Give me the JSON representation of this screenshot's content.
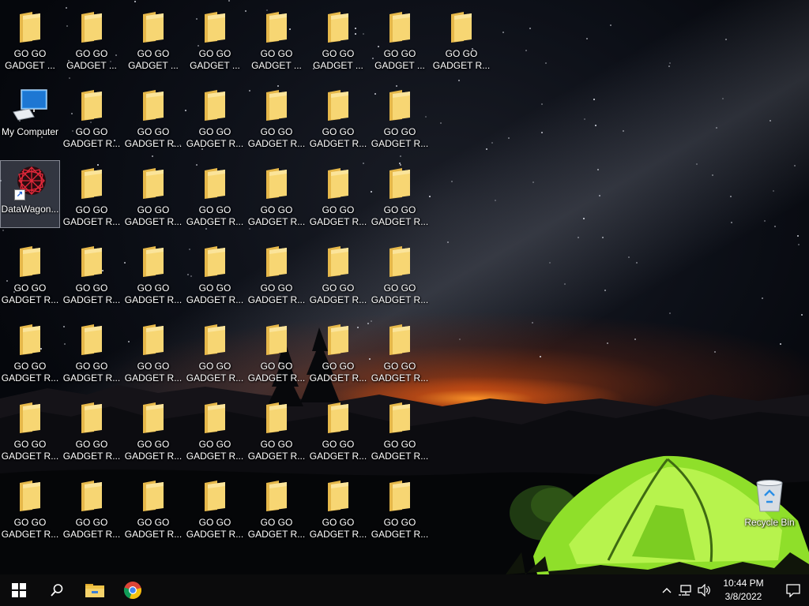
{
  "desktop": {
    "special_icons": [
      {
        "name": "my-computer",
        "label": "My Computer",
        "icon": "computer-icon"
      },
      {
        "name": "datawagon-shortcut",
        "label": "DataWagon...",
        "icon": "datawagon-app-icon",
        "selected": true
      },
      {
        "name": "recycle-bin",
        "label": "Recycle Bin",
        "icon": "recycle-bin-icon"
      }
    ],
    "folder_label": "GO GO GADGET R...",
    "folder_label_row1": "GO GO GADGET ...",
    "folder_label_row1_last": "GO GO GADGET R...",
    "folder_icon": "folder-icon",
    "folder_rows": [
      {
        "count": 8
      },
      {
        "count": 6
      },
      {
        "count": 6
      },
      {
        "count": 7
      },
      {
        "count": 7
      },
      {
        "count": 7
      },
      {
        "count": 7
      }
    ]
  },
  "taskbar": {
    "start_icon": "windows-start-icon",
    "search_icon": "search-icon",
    "pinned": [
      {
        "name": "file-explorer",
        "icon": "file-explorer-icon"
      },
      {
        "name": "chrome",
        "icon": "chrome-icon"
      }
    ],
    "tray": {
      "chevron_icon": "chevron-up-icon",
      "network_icon": "network-icon",
      "volume_icon": "volume-icon",
      "time": "10:44 PM",
      "date": "3/8/2022",
      "notification_icon": "action-center-icon"
    }
  },
  "colors": {
    "taskbar_bg": "#0b0b0c",
    "folder_yellow": "#f3cf6b",
    "tent_green": "#9bea2f"
  }
}
